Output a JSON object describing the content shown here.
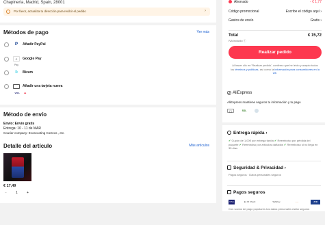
{
  "address": {
    "text": "Chapinería, Madrid, Spain, 28001",
    "warning": "Por favor, actualiza tu dirección para recibir el pedido",
    "chevron": "›"
  },
  "payment": {
    "title": "Métodos de pago",
    "more": "Ver más",
    "methods": [
      {
        "label": "Añadir PayPal",
        "logo": "P"
      },
      {
        "label": "Google Pay",
        "logo": "G Pay"
      },
      {
        "label": "Bizum",
        "logo": "b"
      },
      {
        "label": "Añadir una tarjeta nueva",
        "logo": ""
      }
    ],
    "card_brands": [
      "VISA",
      "●●"
    ]
  },
  "shipping": {
    "title": "Método de envío",
    "method": "Envío: Envío gratis",
    "date": "Entrega: 10 - 11 de MAR",
    "couriers": "Courier company:  Ecoscooting  Correos , etc."
  },
  "detail": {
    "title": "Detalle del artículo",
    "more": "Más artículos",
    "price": "€ 17,49",
    "qty_minus": "−",
    "qty": "1",
    "qty_plus": "+"
  },
  "summary": {
    "ahorrado_label": "Ahorrado",
    "ahorrado_value": "- € 1,77",
    "promo_label": "Código promocional",
    "promo_value": "Escribe el código aquí ›",
    "shipping_label": "Gastos de envío",
    "shipping_value": "Gratis ›",
    "total_label": "Total",
    "total_value": "€ 15,72",
    "iva_note": "IVA incluido ⓘ",
    "place_order": "Realizar pedido",
    "terms_1": "Al hacer clic en 'Realizar pedido', confirmo que he leído y acepto todos los ",
    "terms_link_1": "términos y políticas",
    "terms_2": ", así como la ",
    "terms_link_2": "información para consumidores en la UE",
    "terms_3": "."
  },
  "trust": {
    "brand": "AliExpress",
    "tagline": "AliExpress mantiene seguros tu información y tu pago",
    "badges": [
      "[ ]",
      "SSL",
      ""
    ]
  },
  "fast_delivery": {
    "title": "Entrega rápida ›",
    "line_1": "Cupón de 1,00€ por entrega tardía",
    "line_2": "Reembolso por pérdida del paquete",
    "line_3": "Reembolso por artículos dañados",
    "line_4": "Reembolso si no llega en 35 días"
  },
  "privacy": {
    "title": "Seguridad & Privacidad ›",
    "body": "Pagos seguros · Datos personales seguros"
  },
  "secure_payments": {
    "title": "Pagos seguros",
    "logos": [
      "VISA",
      "●● ID Check",
      "SafeKey",
      "~ ~",
      "JCB"
    ],
    "body": "Con socios de pago populares tus datos personales están seguros"
  },
  "colors": {
    "accent": "#fd384f",
    "link": "#1a5fd1",
    "background": "#f2f2f2"
  }
}
